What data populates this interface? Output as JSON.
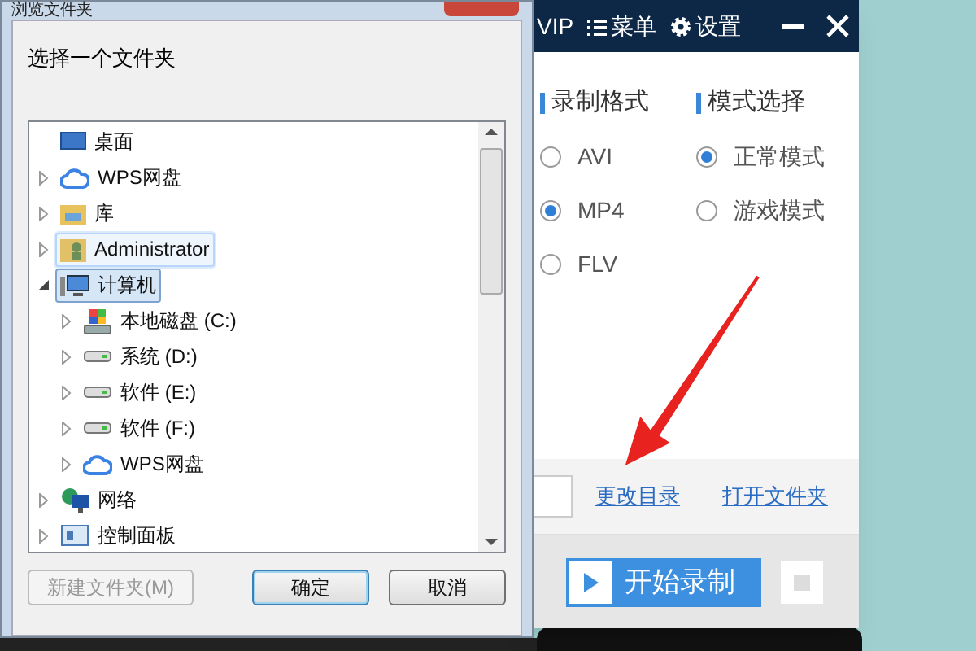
{
  "dialog": {
    "title": "浏览文件夹",
    "prompt": "选择一个文件夹",
    "tree": [
      {
        "label": "桌面",
        "kind": "desktop",
        "expandable": false,
        "selected": false,
        "hovered": false
      },
      {
        "label": "WPS网盘",
        "kind": "cloud",
        "expandable": true,
        "expanded": false,
        "selected": false,
        "hovered": false
      },
      {
        "label": "库",
        "kind": "library",
        "expandable": true,
        "expanded": false,
        "selected": false,
        "hovered": false
      },
      {
        "label": "Administrator",
        "kind": "user",
        "expandable": true,
        "expanded": false,
        "selected": false,
        "hovered": true
      },
      {
        "label": "计算机",
        "kind": "computer",
        "expandable": true,
        "expanded": true,
        "selected": true,
        "hovered": false,
        "children": [
          {
            "label": "本地磁盘 (C:)",
            "kind": "system-drive",
            "expandable": true,
            "expanded": false,
            "selected": false,
            "hovered": false
          },
          {
            "label": "系统 (D:)",
            "kind": "drive",
            "expandable": true,
            "expanded": false,
            "selected": false,
            "hovered": false
          },
          {
            "label": "软件 (E:)",
            "kind": "drive",
            "expandable": true,
            "expanded": false,
            "selected": false,
            "hovered": false
          },
          {
            "label": "软件 (F:)",
            "kind": "drive",
            "expandable": true,
            "expanded": false,
            "selected": false,
            "hovered": false
          },
          {
            "label": "WPS网盘",
            "kind": "cloud",
            "expandable": true,
            "expanded": false,
            "selected": false,
            "hovered": false
          }
        ]
      },
      {
        "label": "网络",
        "kind": "network",
        "expandable": true,
        "expanded": false,
        "selected": false,
        "hovered": false
      },
      {
        "label": "控制面板",
        "kind": "control-panel",
        "expandable": true,
        "expanded": false,
        "selected": false,
        "hovered": false
      }
    ],
    "buttons": [
      {
        "label": "新建文件夹(M)",
        "disabled": true,
        "focused": false
      },
      {
        "label": "确定",
        "disabled": false,
        "focused": true
      },
      {
        "label": "取消",
        "disabled": false,
        "focused": false
      }
    ]
  },
  "app": {
    "header": [
      {
        "label": "VIP",
        "kind": "text"
      },
      {
        "label": "菜单",
        "kind": "menu"
      },
      {
        "label": "设置",
        "kind": "settings"
      }
    ],
    "groups": [
      {
        "title": "录制格式",
        "options": [
          {
            "label": "AVI",
            "selected": false
          },
          {
            "label": "MP4",
            "selected": true
          },
          {
            "label": "FLV",
            "selected": false
          }
        ]
      },
      {
        "title": "模式选择",
        "options": [
          {
            "label": "正常模式",
            "selected": true
          },
          {
            "label": "游戏模式",
            "selected": false
          }
        ]
      }
    ],
    "links": [
      "更改目录",
      "打开文件夹"
    ],
    "record_button": "开始录制"
  }
}
